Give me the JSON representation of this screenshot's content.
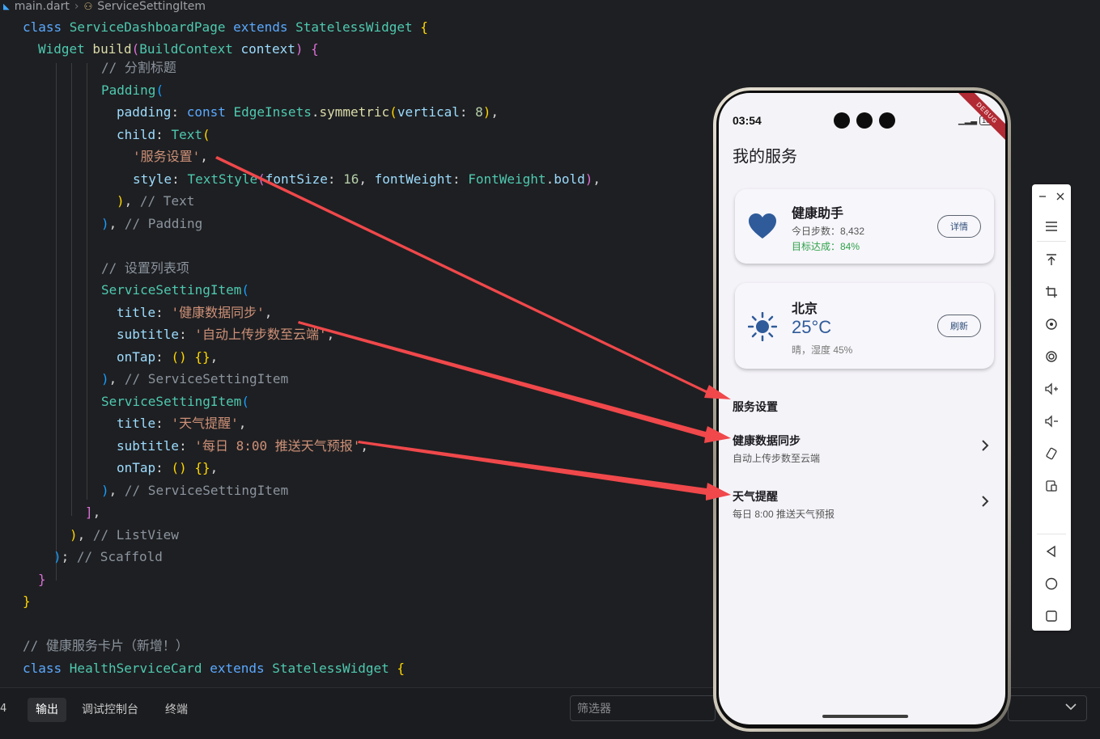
{
  "breadcrumb": {
    "file": "main.dart",
    "symbol": "ServiceSettingItem"
  },
  "code": {
    "l1": {
      "kw": "class ",
      "cls": "ServiceDashboardPage",
      "ext": " extends ",
      "base": "StatelessWidget",
      "brace": " {"
    },
    "l2": {
      "type": "Widget",
      "fn": " build",
      "p1": "(",
      "ptype": "BuildContext",
      "pname": " context",
      "p2": ")",
      "brace": " {"
    },
    "l3": "// 分割标题",
    "l4": {
      "cls": "Padding",
      "p": "("
    },
    "l5": {
      "prop": "padding",
      "colon": ": ",
      "kw": "const ",
      "cls": "EdgeInsets",
      "dot": ".",
      "fn": "symmetric",
      "p1": "(",
      "arg": "vertical",
      "colon2": ": ",
      "num": "8",
      "p2": ")",
      "comma": ","
    },
    "l6": {
      "prop": "child",
      "colon": ": ",
      "cls": "Text",
      "p": "("
    },
    "l7": {
      "str": "'服务设置'",
      "comma": ","
    },
    "l8": {
      "prop": "style",
      "colon": ": ",
      "cls": "TextStyle",
      "p1": "(",
      "a1": "fontSize",
      "c1": ": ",
      "n1": "16",
      "sep": ", ",
      "a2": "fontWeight",
      "c2": ": ",
      "cls2": "FontWeight",
      "dot": ".",
      "v2": "bold",
      "p2": ")",
      "comma": ","
    },
    "l9": {
      "p": ")",
      "rest": ", ",
      "cmt": "// Text"
    },
    "l10": {
      "p": ")",
      "rest": ", ",
      "cmt": "// Padding"
    },
    "l11": "// 设置列表项",
    "l12": {
      "cls": "ServiceSettingItem",
      "p": "("
    },
    "l13": {
      "prop": "title",
      "colon": ": ",
      "str": "'健康数据同步'",
      "comma": ","
    },
    "l14": {
      "prop": "subtitle",
      "colon": ": ",
      "str": "'自动上传步数至云端'",
      "comma": ","
    },
    "l15": {
      "prop": "onTap",
      "colon": ": ",
      "p1": "()",
      "body": " {}",
      "comma": ","
    },
    "l16": {
      "p": ")",
      "rest": ", ",
      "cmt": "// ServiceSettingItem"
    },
    "l17": {
      "cls": "ServiceSettingItem",
      "p": "("
    },
    "l18": {
      "prop": "title",
      "colon": ": ",
      "str": "'天气提醒'",
      "comma": ","
    },
    "l19": {
      "prop": "subtitle",
      "colon": ": ",
      "str": "'每日 8:00 推送天气预报'",
      "comma": ","
    },
    "l20": {
      "prop": "onTap",
      "colon": ": ",
      "p1": "()",
      "body": " {}",
      "comma": ","
    },
    "l21": {
      "p": ")",
      "rest": ", ",
      "cmt": "// ServiceSettingItem"
    },
    "l22": {
      "p": "]",
      "rest": ","
    },
    "l23": {
      "p": ")",
      "rest": ", ",
      "cmt": "// ListView"
    },
    "l24": {
      "p": ")",
      "rest": "; ",
      "cmt": "// Scaffold"
    },
    "l25": "}",
    "l26": "}",
    "l27": "// 健康服务卡片（新增！）",
    "l28": {
      "kw": "class ",
      "cls": "HealthServiceCard",
      "ext": " extends ",
      "base": "StatelessWidget",
      "brace": " {"
    }
  },
  "panel": {
    "badge": "4",
    "tabs": [
      "输出",
      "调试控制台",
      "终端"
    ],
    "filter_placeholder": "筛选器"
  },
  "phone": {
    "time": "03:54",
    "battery": "100",
    "debug_banner": "DEBUG",
    "appbar_title": "我的服务",
    "health_card": {
      "title": "健康助手",
      "steps": "今日步数：8,432",
      "goal": "目标达成：84%",
      "button": "详情",
      "icon": "heart-icon"
    },
    "weather_card": {
      "title": "北京",
      "temp": "25°C",
      "desc": "晴，湿度 45%",
      "button": "刷新",
      "icon": "sun-icon"
    },
    "section_title": "服务设置",
    "items": [
      {
        "title": "健康数据同步",
        "subtitle": "自动上传步数至云端"
      },
      {
        "title": "天气提醒",
        "subtitle": "每日 8:00 推送天气预报"
      }
    ]
  },
  "colors": {
    "arrow": "#f0484b",
    "accent_blue": "#2f5b9a",
    "green": "#2fa24a",
    "editor_bg": "#1e1f22"
  }
}
